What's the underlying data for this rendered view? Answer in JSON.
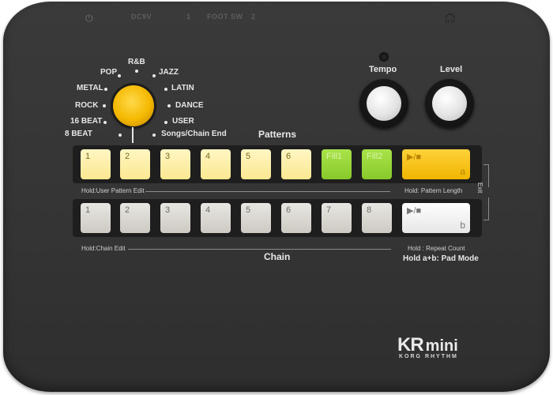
{
  "top_panel": {
    "power_symbol": "⏻",
    "dc_label": "DC9V",
    "foot_sw_1": "1",
    "foot_sw_label": "FOOT SW",
    "foot_sw_2": "2",
    "headphone_symbol": "🎧"
  },
  "style_selector": {
    "options": [
      "8 BEAT",
      "16 BEAT",
      "ROCK",
      "METAL",
      "POP",
      "R&B",
      "JAZZ",
      "LATIN",
      "DANCE",
      "USER",
      "Songs/Chain End"
    ]
  },
  "controls": {
    "tempo_label": "Tempo",
    "level_label": "Level"
  },
  "patterns": {
    "title": "Patterns",
    "pads": [
      "1",
      "2",
      "3",
      "4",
      "5",
      "6",
      "Fill1",
      "Fill2"
    ],
    "play_label": "▶/■",
    "play_sub": "a",
    "hold_left": "Hold:User Pattern Edit",
    "hold_right": "Hold: Pattern Length"
  },
  "chain": {
    "title": "Chain",
    "pads": [
      "1",
      "2",
      "3",
      "4",
      "5",
      "6",
      "7",
      "8"
    ],
    "play_label": "▶/■",
    "play_sub": "b",
    "hold_left": "Hold:Chain Edit",
    "hold_right": "Hold : Repeat Count",
    "pad_mode": "Hold a+b: Pad Mode"
  },
  "exit_label": "Exit",
  "brand": {
    "kr": "KR",
    "mini": "mini",
    "sub": "KORG RHYTHM"
  },
  "colors": {
    "body": "#353535",
    "selector": "#f4b800",
    "pattern_pad": "#fbe890",
    "fill_pad": "#88c92a",
    "play_a": "#f0b500"
  }
}
